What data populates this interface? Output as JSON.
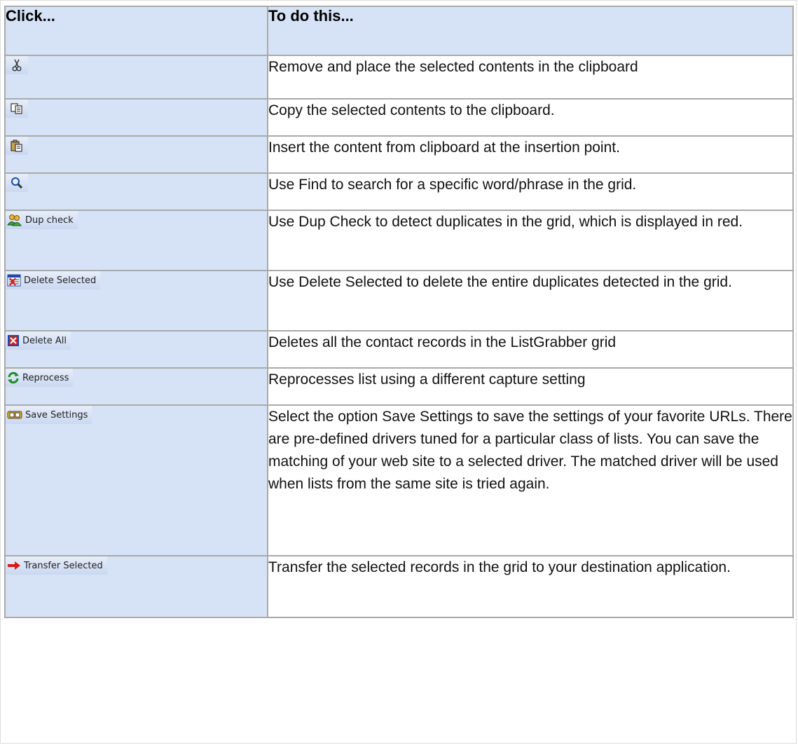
{
  "header": {
    "col1": "Click...",
    "col2": "To do this..."
  },
  "rows": [
    {
      "icon": "cut-icon",
      "label": "",
      "desc": "Remove and place the selected contents in the clipboard"
    },
    {
      "icon": "copy-icon",
      "label": "",
      "desc": "Copy the selected contents to the clipboard."
    },
    {
      "icon": "paste-icon",
      "label": "",
      "desc": "Insert the content from clipboard at the insertion point."
    },
    {
      "icon": "find-icon",
      "label": "",
      "desc": "Use Find to search for a specific word/phrase in the grid."
    },
    {
      "icon": "dup-check-icon",
      "label": "Dup check",
      "desc": "Use Dup Check to detect duplicates in the grid, which is displayed in red."
    },
    {
      "icon": "delete-selected-icon",
      "label": "Delete Selected",
      "desc": "Use Delete Selected to delete the entire duplicates detected in the grid."
    },
    {
      "icon": "delete-all-icon",
      "label": "Delete All",
      "desc": "Deletes all the contact records in the ListGrabber grid"
    },
    {
      "icon": "reprocess-icon",
      "label": "Reprocess",
      "desc": "Reprocesses list using a different capture setting"
    },
    {
      "icon": "save-settings-icon",
      "label": "Save Settings",
      "desc": "Select the option Save Settings to save the settings of your favorite URLs. There are pre-defined drivers tuned for a particular class of lists. You can save the matching of your web site to a selected driver. The matched driver will be used when lists from the same site is tried again."
    },
    {
      "icon": "transfer-arrow-icon",
      "label": "Transfer Selected",
      "desc": "Transfer the selected records in the grid to your destination application."
    }
  ]
}
